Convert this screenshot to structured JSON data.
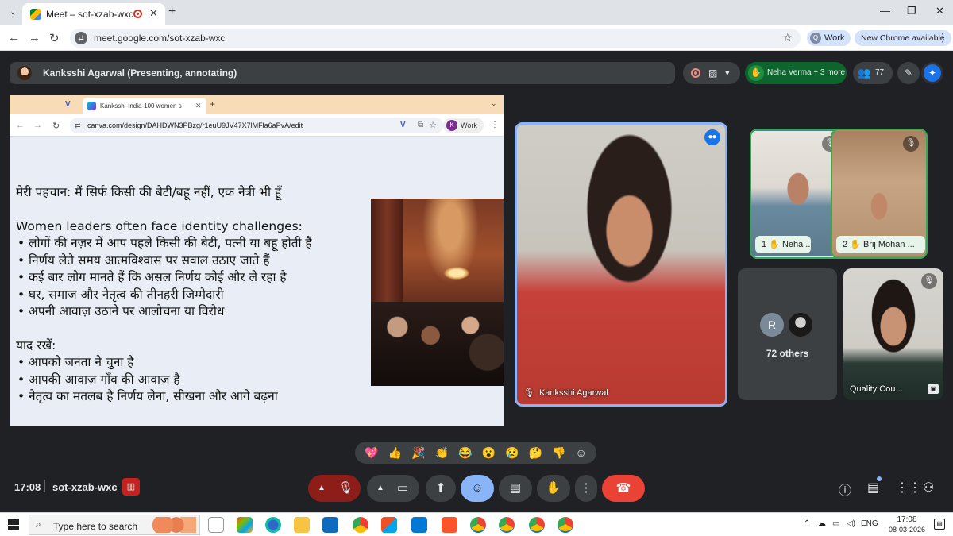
{
  "browser": {
    "tab_title": "Meet – sot-xzab-wxc",
    "tab_close": "✕",
    "new_tab": "+",
    "url": "meet.google.com/sot-xzab-wxc",
    "profile_initial": "Q",
    "profile_label": "Work",
    "update_label": "New Chrome available",
    "window_controls": [
      "—",
      "❐",
      "✕"
    ]
  },
  "meet_header": {
    "presenter_label": "Kanksshi Agarwal (Presenting, annotating)",
    "hands_label": "Neha Verma + 3 more",
    "participant_count": "77"
  },
  "shared_screen": {
    "tab_title": "Kanksshi-India-100 women s",
    "url": "canva.com/design/DAHDWN3PBzg/r1euU9JV47X7lMFla6aPvA/edit",
    "profile_initial": "K",
    "profile_label": "Work",
    "slide": {
      "title": "मेरी पहचान: मैं सिर्फ किसी की बेटी/बहू नहीं, एक नेत्री भी हूँ",
      "heading1": "Women leaders often face identity challenges:",
      "bullets1": [
        "लोगों की नज़र में आप पहले किसी की बेटी, पत्नी या बहू होती हैं",
        "निर्णय लेते समय आत्मविश्वास पर सवाल उठाए जाते हैं",
        "कई बार लोग मानते हैं कि असल निर्णय कोई और ले रहा है",
        "घर, समाज और नेतृत्व की तीनहरी जिम्मेदारी",
        "अपनी आवाज़ उठाने पर आलोचना या विरोध"
      ],
      "heading2": "याद रखें:",
      "bullets2": [
        "आपको जनता ने चुना है",
        "आपकी आवाज़ गाँव की आवाज़ है",
        "नेतृत्व का मतलब है निर्णय लेना, सीखना और आगे बढ़ना"
      ]
    }
  },
  "participants": {
    "main": {
      "name": "Kanksshi Agarwal"
    },
    "neha": {
      "hand_order": "1",
      "name": "Neha ..."
    },
    "brij": {
      "hand_order": "2",
      "name": "Brij Mohan ..."
    },
    "others": {
      "avatar_initial": "R",
      "label": "72 others"
    },
    "quality": {
      "name": "Quality Cou..."
    }
  },
  "reactions": [
    "💖",
    "👍",
    "🎉",
    "👏",
    "😂",
    "😮",
    "😢",
    "🤔",
    "👎",
    "☺"
  ],
  "bottom_bar": {
    "time": "17:08",
    "meeting_code": "sot-xzab-wxc"
  },
  "taskbar": {
    "search_placeholder": "Type here to search",
    "language": "ENG",
    "clock_time": "17:08",
    "clock_date": "08-03-2026"
  }
}
